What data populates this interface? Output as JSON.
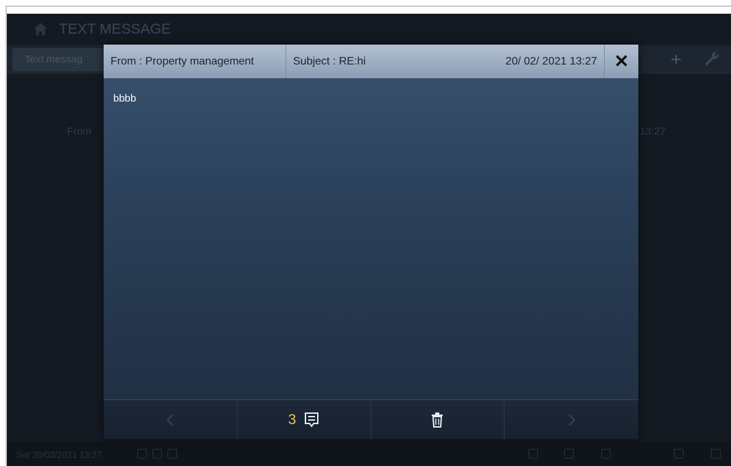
{
  "background": {
    "title": "TEXT MESSAGE",
    "tab_label": "Text messag",
    "row_from": "From",
    "row_time": "13:27",
    "status_datetime": "Sat 20/02/2021  13:27"
  },
  "dialog": {
    "from": "From : Property management",
    "subject": "Subject : RE:hi",
    "datetime": "20/ 02/ 2021  13:27",
    "close_label": "✕",
    "body": "bbbb",
    "footer": {
      "prev_label": "<",
      "count": "3",
      "next_label": ">"
    }
  },
  "colors": {
    "accent_count": "#e8c34a",
    "header_bg": "#a4b3c7",
    "dialog_bg": "#2b405a"
  }
}
